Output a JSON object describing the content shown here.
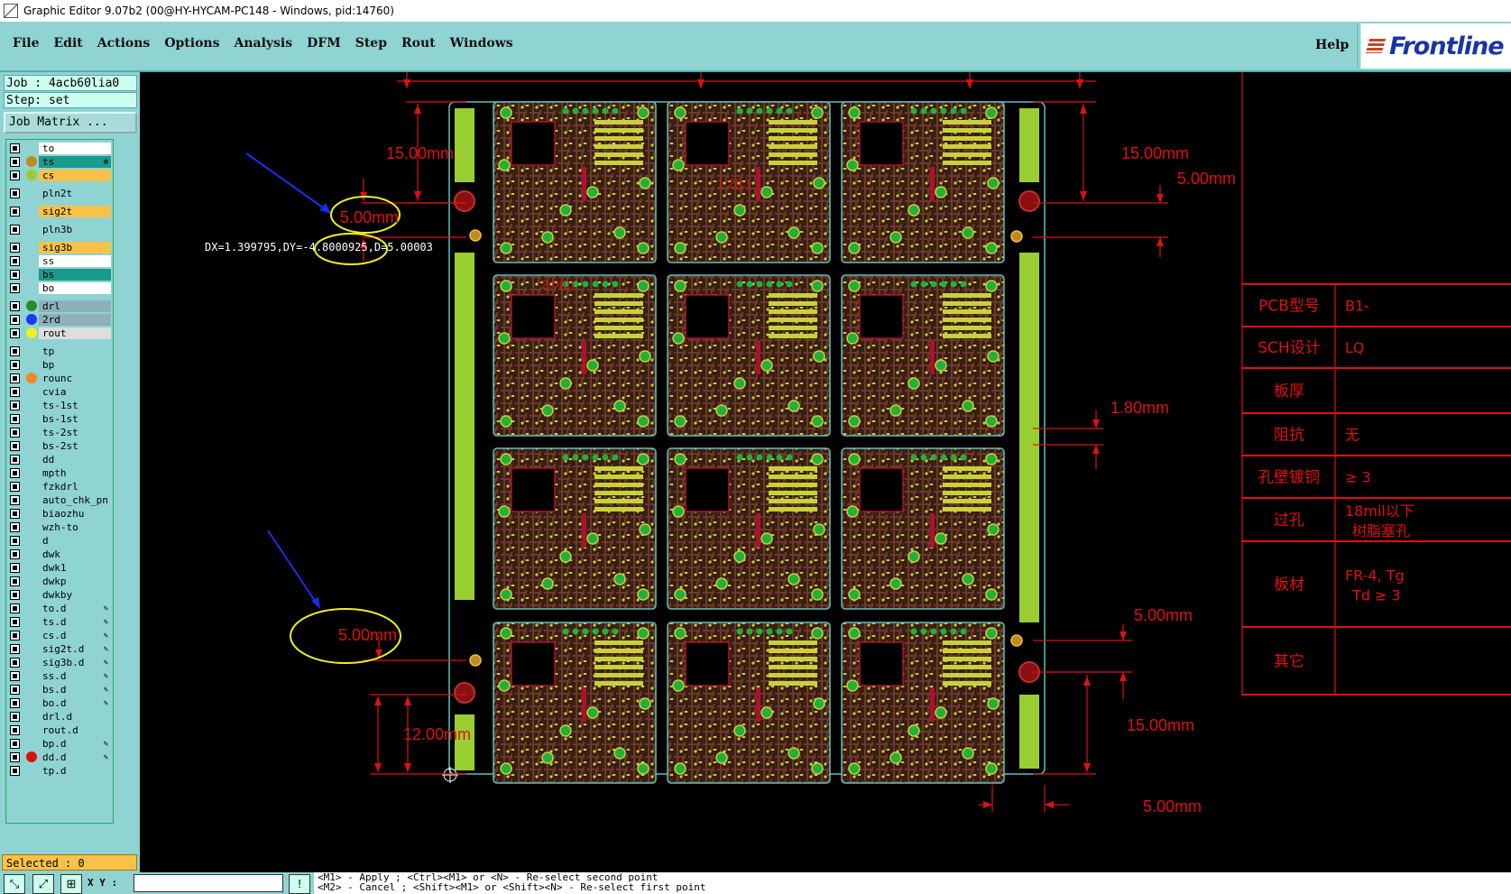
{
  "window": {
    "title": "Graphic Editor 9.07b2 (00@HY-HYCAM-PC148 - Windows, pid:14760)"
  },
  "menu": {
    "file": "File",
    "edit": "Edit",
    "actions": "Actions",
    "options": "Options",
    "analysis": "Analysis",
    "dfm": "DFM",
    "step": "Step",
    "rout": "Rout",
    "windows": "Windows",
    "help": "Help"
  },
  "brand": {
    "logo": "Frontline"
  },
  "job": {
    "job_line": "Job : 4acb60lia0",
    "step_line": "Step: set",
    "matrix_button": "Job Matrix ..."
  },
  "layers": [
    {
      "name": "to",
      "color": "#ffffff",
      "dot": ""
    },
    {
      "name": "ts",
      "color": "#1a9a8a",
      "dot": "#c08a20",
      "edit": "⊕"
    },
    {
      "name": "cs",
      "color": "#f8c24a",
      "dot": "#9acd32"
    },
    {
      "name": "pln2t",
      "color": "#8fd3d2",
      "dot": ""
    },
    {
      "name": "sig2t",
      "color": "#f8c24a",
      "dot": ""
    },
    {
      "name": "pln3b",
      "color": "#8fd3d2",
      "dot": ""
    },
    {
      "name": "sig3b",
      "color": "#f8c24a",
      "dot": ""
    },
    {
      "name": "ss",
      "color": "#ffffff",
      "dot": ""
    },
    {
      "name": "bs",
      "color": "#1a9a8a",
      "dot": ""
    },
    {
      "name": "bo",
      "color": "#ffffff",
      "dot": ""
    },
    {
      "name": "drl",
      "color": "#8fb0b8",
      "dot": "#2a8a2a"
    },
    {
      "name": "2rd",
      "color": "#8fb0b8",
      "dot": "#1a3af0"
    },
    {
      "name": "rout",
      "color": "#dddddd",
      "dot": "#f0f020"
    },
    {
      "name": "tp",
      "color": "#8fd3d2",
      "dot": ""
    },
    {
      "name": "bp",
      "color": "#8fd3d2",
      "dot": ""
    },
    {
      "name": "rounc",
      "color": "#8fd3d2",
      "dot": "#f08a20"
    },
    {
      "name": "cvia",
      "color": "#8fd3d2",
      "dot": ""
    },
    {
      "name": "ts-1st",
      "color": "#8fd3d2",
      "dot": ""
    },
    {
      "name": "bs-1st",
      "color": "#8fd3d2",
      "dot": ""
    },
    {
      "name": "ts-2st",
      "color": "#8fd3d2",
      "dot": ""
    },
    {
      "name": "bs-2st",
      "color": "#8fd3d2",
      "dot": ""
    },
    {
      "name": "dd",
      "color": "#8fd3d2",
      "dot": ""
    },
    {
      "name": "mpth",
      "color": "#8fd3d2",
      "dot": ""
    },
    {
      "name": "fzkdrl",
      "color": "#8fd3d2",
      "dot": ""
    },
    {
      "name": "auto_chk_pn",
      "color": "#8fd3d2",
      "dot": ""
    },
    {
      "name": "biaozhu",
      "color": "#8fd3d2",
      "dot": ""
    },
    {
      "name": "wzh-to",
      "color": "#8fd3d2",
      "dot": ""
    },
    {
      "name": "d",
      "color": "#8fd3d2",
      "dot": ""
    },
    {
      "name": "dwk",
      "color": "#8fd3d2",
      "dot": ""
    },
    {
      "name": "dwk1",
      "color": "#8fd3d2",
      "dot": ""
    },
    {
      "name": "dwkp",
      "color": "#8fd3d2",
      "dot": ""
    },
    {
      "name": "dwkby",
      "color": "#8fd3d2",
      "dot": ""
    },
    {
      "name": "to.d",
      "color": "#8fd3d2",
      "dot": "",
      "edit": "✎"
    },
    {
      "name": "ts.d",
      "color": "#8fd3d2",
      "dot": "",
      "edit": "✎"
    },
    {
      "name": "cs.d",
      "color": "#8fd3d2",
      "dot": "",
      "edit": "✎"
    },
    {
      "name": "sig2t.d",
      "color": "#8fd3d2",
      "dot": "",
      "edit": "✎"
    },
    {
      "name": "sig3b.d",
      "color": "#8fd3d2",
      "dot": "",
      "edit": "✎"
    },
    {
      "name": "ss.d",
      "color": "#8fd3d2",
      "dot": "",
      "edit": "✎"
    },
    {
      "name": "bs.d",
      "color": "#8fd3d2",
      "dot": "",
      "edit": "✎"
    },
    {
      "name": "bo.d",
      "color": "#8fd3d2",
      "dot": "",
      "edit": "✎"
    },
    {
      "name": "drl.d",
      "color": "#8fd3d2",
      "dot": ""
    },
    {
      "name": "rout.d",
      "color": "#8fd3d2",
      "dot": ""
    },
    {
      "name": "bp.d",
      "color": "#8fd3d2",
      "dot": "",
      "edit": "✎"
    },
    {
      "name": "dd.d",
      "color": "#8fd3d2",
      "dot": "#e01010",
      "edit": "✎"
    },
    {
      "name": "tp.d",
      "color": "#8fd3d2",
      "dot": ""
    }
  ],
  "status": {
    "selected": "Selected : 0",
    "xy_label": "X Y :",
    "xy_value": ""
  },
  "messages": {
    "line1": "<M1> - Apply  ; <Ctrl><M1> or <N> - Re-select second point",
    "line2": "<M2> - Cancel ; <Shift><M1> or <Shift><N> - Re-select first point"
  },
  "measure": {
    "readout": "DX=1.399795,DY=-4.8000925,D=5.00003"
  },
  "dims": {
    "d15_tl": "15.00mm",
    "d5_l": "5.00mm",
    "d15_tr": "15.00mm",
    "d5_tr": "5.00mm",
    "d180": "1.80mm",
    "d5_lb": "5.00mm",
    "d5_rb": "5.00mm",
    "d12": "12.00mm",
    "d15_br": "15.00mm",
    "d5_bottom": "5.00mm",
    "d1_2": "1.2(L)",
    "d2_0": "2.0(L)"
  },
  "spec_table": {
    "rows": [
      {
        "label": "PCB型号",
        "value": "B1-"
      },
      {
        "label": "SCH设计",
        "value": "LQ"
      },
      {
        "label": "板厚",
        "value": ""
      },
      {
        "label": "阻抗",
        "value": "无"
      },
      {
        "label": "孔壁镀铜",
        "value": "≥ 3"
      },
      {
        "label": "过孔",
        "value": "18mil以下",
        "value2": "树脂塞孔"
      },
      {
        "label": "板材",
        "value": "FR-4, Tg",
        "value2": "Td ≥ 3"
      },
      {
        "label": "其它",
        "value": ""
      }
    ]
  },
  "colors": {
    "accent": "#8fd3d2",
    "selected_bg": "#f8c24a",
    "dimension": "#e01010",
    "pad": "#9acd32",
    "copper": "#6b3a2a",
    "outline": "#5fbfbf"
  }
}
